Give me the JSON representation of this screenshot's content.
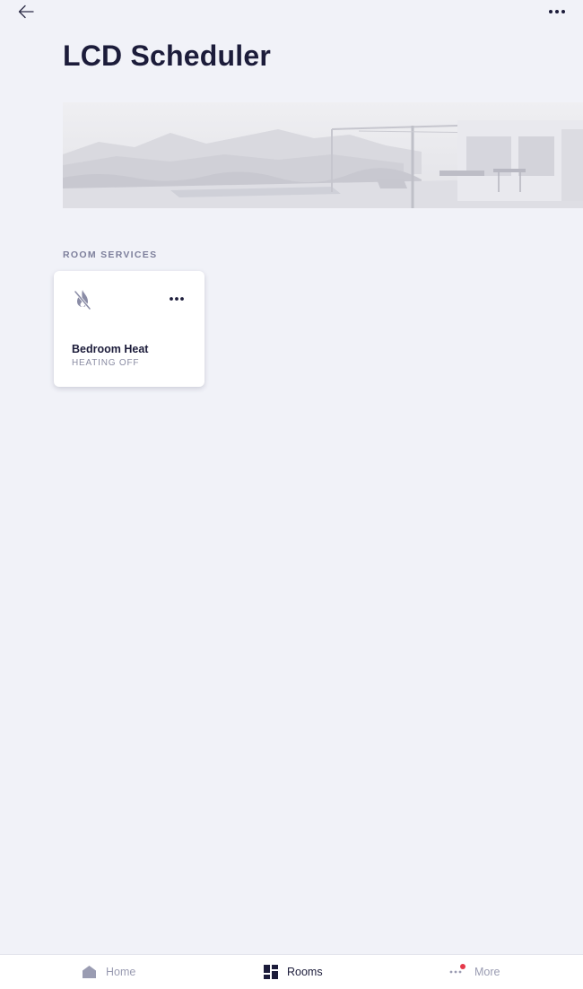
{
  "header": {
    "title": "LCD Scheduler",
    "back_icon": "arrow-left-icon",
    "menu_icon": "more-horizontal-icon"
  },
  "hero": {
    "image_subject": "modern house terrace with pool and mountains"
  },
  "section": {
    "heading": "ROOM SERVICES"
  },
  "services": [
    {
      "name": "Bedroom Heat",
      "status": "HEATING OFF",
      "icon": "flame-off-icon",
      "menu_icon": "more-horizontal-icon"
    }
  ],
  "bottom_nav": {
    "items": [
      {
        "label": "Home",
        "icon": "home-icon",
        "active": false
      },
      {
        "label": "Rooms",
        "icon": "rooms-grid-icon",
        "active": true
      },
      {
        "label": "More",
        "icon": "more-horizontal-icon",
        "active": false,
        "notification": true
      }
    ]
  },
  "colors": {
    "background": "#f1f2f8",
    "text_primary": "#1c1c3a",
    "text_muted": "#9a9cb2",
    "notification": "#e5394a"
  }
}
